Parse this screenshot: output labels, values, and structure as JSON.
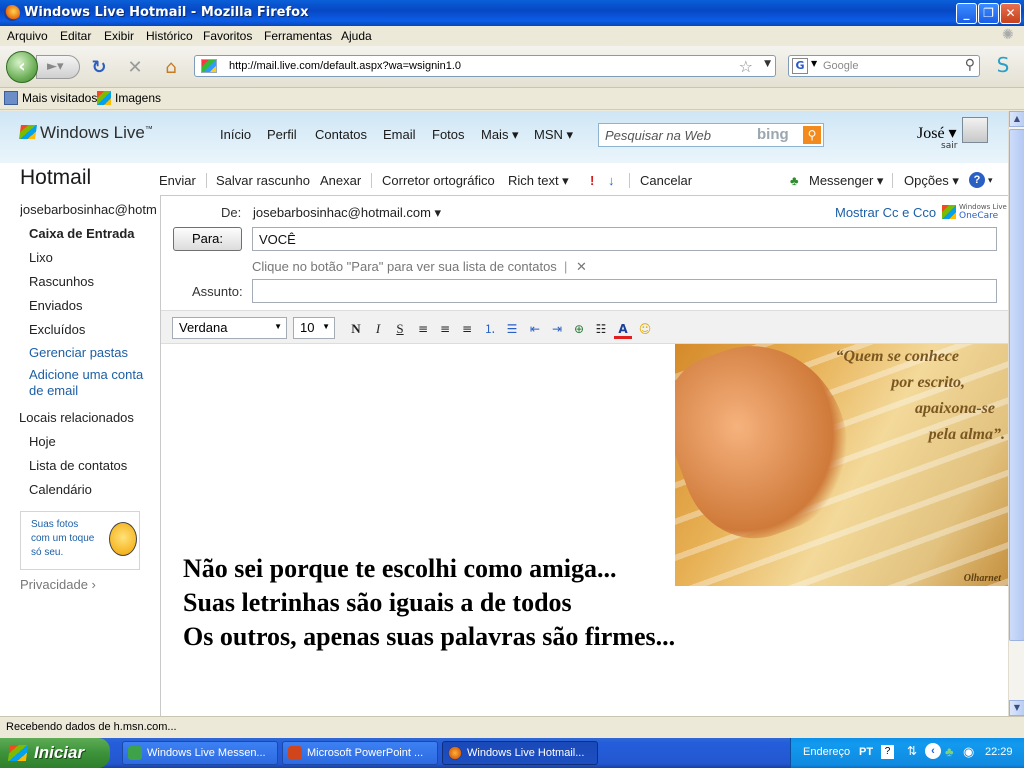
{
  "window": {
    "title": "Windows Live Hotmail - Mozilla Firefox",
    "min": "_",
    "max": "❐",
    "close": "✕"
  },
  "menu": [
    "Arquivo",
    "Editar",
    "Exibir",
    "Histórico",
    "Favoritos",
    "Ferramentas",
    "Ajuda"
  ],
  "nav": {
    "url": "http://mail.live.com/default.aspx?wa=wsignin1.0",
    "search_placeholder": "Google",
    "search_engine_letter": "G"
  },
  "bookmarks": [
    "Mais visitados",
    "Imagens"
  ],
  "hotmail": {
    "logo": "Windows Live",
    "logo_tm": "™",
    "top_nav": [
      "Início",
      "Perfil",
      "Contatos",
      "Email",
      "Fotos",
      "Mais ▾",
      "MSN ▾"
    ],
    "web_search_placeholder": "Pesquisar na Web",
    "bing": "bing",
    "user": {
      "name": "José ▾",
      "signout": "sair"
    },
    "title": "Hotmail",
    "toolbar": {
      "send": "Enviar",
      "save_draft": "Salvar rascunho",
      "attach": "Anexar",
      "spell_check": "Corretor ortográfico",
      "rich_text": "Rich text ▾",
      "high_priority": "!",
      "low_priority": "↓",
      "cancel": "Cancelar",
      "messenger": "Messenger ▾",
      "options": "Opções ▾",
      "help": "? ▾"
    },
    "sidebar": {
      "account": "josebarbosinhac@hotm...",
      "folders": [
        "Caixa de Entrada",
        "Lixo",
        "Rascunhos",
        "Enviados",
        "Excluídos"
      ],
      "links": [
        "Gerenciar pastas",
        "Adicione uma conta",
        "de email"
      ],
      "related_heading": "Locais relacionados",
      "related": [
        "Hoje",
        "Lista de contatos",
        "Calendário"
      ],
      "photo_promo": [
        "Suas fotos",
        "com um toque",
        "só seu."
      ],
      "privacy": "Privacidade  ›"
    },
    "compose": {
      "from_label": "De:",
      "from_value": "josebarbosinhac@hotmail.com ▾",
      "show_cc": "Mostrar Cc e Cco",
      "onecare": [
        "Windows Live",
        "OneCare"
      ],
      "to_button": "Para:",
      "to_value": "VOCÊ",
      "hint": "Clique no botão \"Para\" para ver sua lista de contatos",
      "hint_close": "✕",
      "subject_label": "Assunto:",
      "subject_value": "",
      "font": "Verdana",
      "size": "10",
      "format_buttons": [
        "N",
        "I",
        "S"
      ],
      "quote_lines": [
        "“Quem se conhece",
        "por escrito,",
        "apaixona-se",
        "pela alma”."
      ],
      "image_signature": "Olharnet",
      "body_lines": [
        "Não sei porque te escolhi como amiga...",
        "Suas letrinhas são iguais a de todos",
        "Os outros, apenas suas palavras são firmes..."
      ]
    }
  },
  "status": "Recebendo dados de h.msn.com...",
  "taskbar": {
    "start": "Iniciar",
    "tasks": [
      "Windows Live Messen...",
      "Microsoft PowerPoint ...",
      "Windows Live Hotmail..."
    ],
    "tray": {
      "address": "Endereço",
      "lang": "PT",
      "time": "22:29"
    }
  }
}
